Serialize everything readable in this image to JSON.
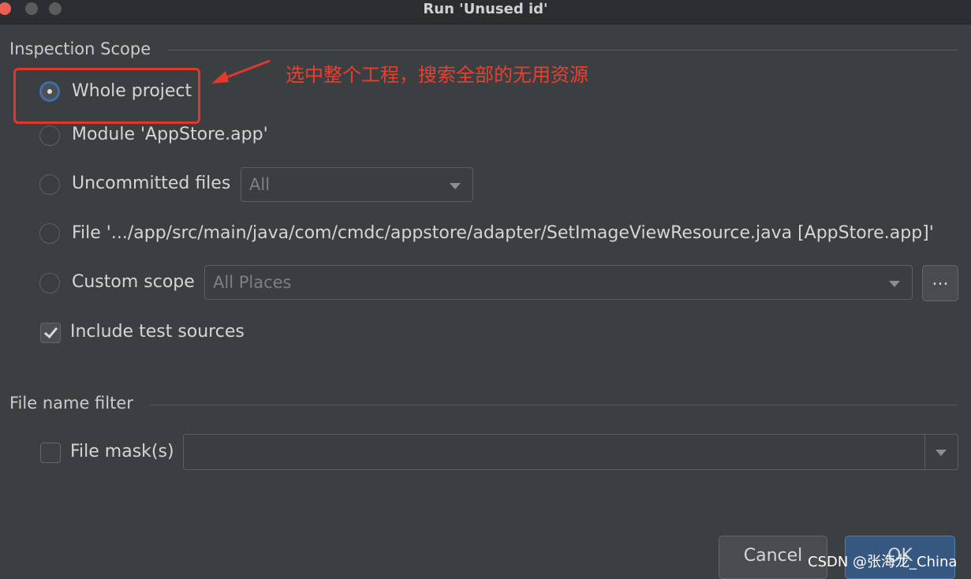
{
  "window": {
    "title": "Run 'Unused id'"
  },
  "scope": {
    "section_title": "Inspection Scope",
    "whole_project": "Whole project",
    "module": "Module 'AppStore.app'",
    "uncommitted": "Uncommitted files",
    "uncommitted_value": "All",
    "file": "File '.../app/src/main/java/com/cmdc/appstore/adapter/SetImageViewResource.java [AppStore.app]'",
    "custom": "Custom scope",
    "custom_value": "All Places",
    "browse_label": "...",
    "include_tests": "Include test sources",
    "selected": "whole_project",
    "include_tests_checked": true
  },
  "filter": {
    "section_title": "File name filter",
    "file_masks": "File mask(s)",
    "file_masks_checked": false,
    "file_masks_value": ""
  },
  "buttons": {
    "cancel": "Cancel",
    "ok": "OK"
  },
  "annotation": {
    "text": "选中整个工程，搜索全部的无用资源",
    "color": "#e8402f"
  },
  "watermark": "CSDN @张海龙_China",
  "colors": {
    "background": "#3c3f41",
    "accent": "#3e6fa6",
    "annotation_red": "#e0382b"
  }
}
